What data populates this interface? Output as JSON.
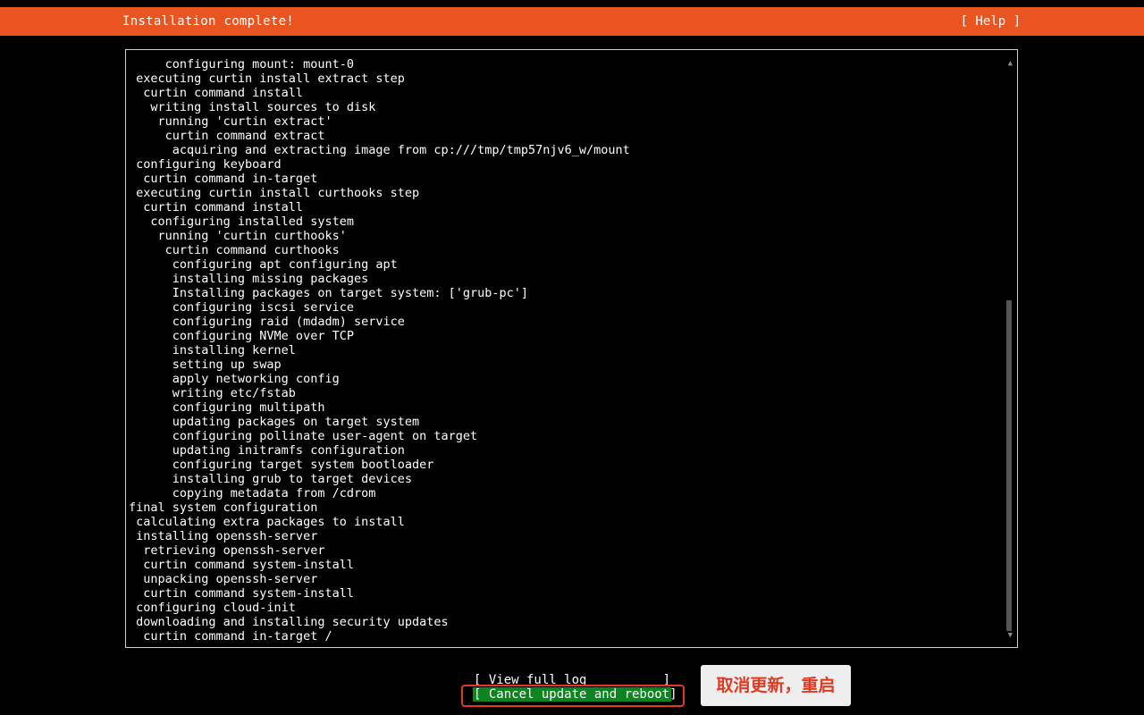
{
  "header": {
    "title": "Installation complete!",
    "help_label": "[ Help ]"
  },
  "colors": {
    "header_bg": "#e95420",
    "primary_button_bg": "#0e8420",
    "annotation_text": "#e03a22",
    "highlight_border": "#e03a22"
  },
  "log": {
    "lines": [
      "     configuring mount: mount-0",
      " executing curtin install extract step",
      "  curtin command install",
      "   writing install sources to disk",
      "    running 'curtin extract'",
      "     curtin command extract",
      "      acquiring and extracting image from cp:///tmp/tmp57njv6_w/mount",
      " configuring keyboard",
      "  curtin command in-target",
      " executing curtin install curthooks step",
      "  curtin command install",
      "   configuring installed system",
      "    running 'curtin curthooks'",
      "     curtin command curthooks",
      "      configuring apt configuring apt",
      "      installing missing packages",
      "      Installing packages on target system: ['grub-pc']",
      "      configuring iscsi service",
      "      configuring raid (mdadm) service",
      "      configuring NVMe over TCP",
      "      installing kernel",
      "      setting up swap",
      "      apply networking config",
      "      writing etc/fstab",
      "      configuring multipath",
      "      updating packages on target system",
      "      configuring pollinate user-agent on target",
      "      updating initramfs configuration",
      "      configuring target system bootloader",
      "      installing grub to target devices",
      "      copying metadata from /cdrom",
      "final system configuration",
      " calculating extra packages to install",
      " installing openssh-server",
      "  retrieving openssh-server",
      "  curtin command system-install",
      "  unpacking openssh-server",
      "  curtin command system-install",
      " configuring cloud-init",
      " downloading and installing security updates",
      "  curtin command in-target /"
    ],
    "scroll_up_glyph": "▲",
    "scroll_down_glyph": "▼"
  },
  "actions": {
    "view_log": {
      "open": "[ View full log",
      "close": "]"
    },
    "cancel_reboot": {
      "open": "[ Cancel update and reboot",
      "close": "]"
    }
  },
  "annotation": {
    "text": "取消更新，重启"
  }
}
